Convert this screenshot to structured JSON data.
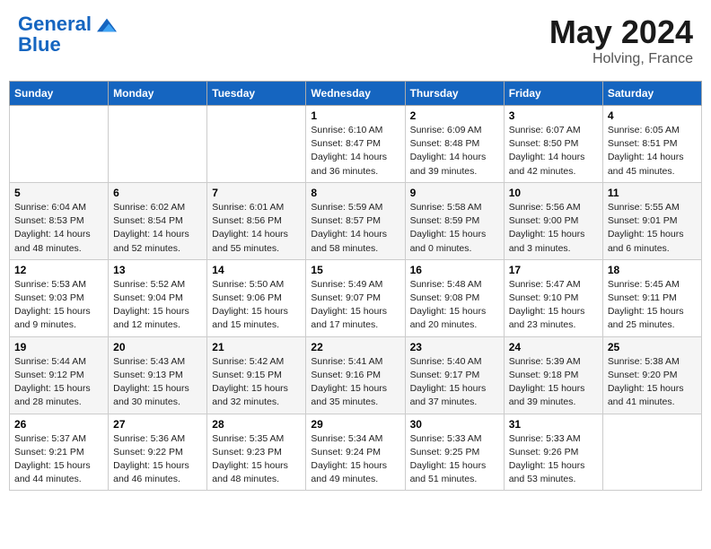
{
  "header": {
    "logo_line1": "General",
    "logo_line2": "Blue",
    "month_year": "May 2024",
    "location": "Holving, France"
  },
  "days_of_week": [
    "Sunday",
    "Monday",
    "Tuesday",
    "Wednesday",
    "Thursday",
    "Friday",
    "Saturday"
  ],
  "weeks": [
    [
      {
        "day": "",
        "content": ""
      },
      {
        "day": "",
        "content": ""
      },
      {
        "day": "",
        "content": ""
      },
      {
        "day": "1",
        "content": "Sunrise: 6:10 AM\nSunset: 8:47 PM\nDaylight: 14 hours\nand 36 minutes."
      },
      {
        "day": "2",
        "content": "Sunrise: 6:09 AM\nSunset: 8:48 PM\nDaylight: 14 hours\nand 39 minutes."
      },
      {
        "day": "3",
        "content": "Sunrise: 6:07 AM\nSunset: 8:50 PM\nDaylight: 14 hours\nand 42 minutes."
      },
      {
        "day": "4",
        "content": "Sunrise: 6:05 AM\nSunset: 8:51 PM\nDaylight: 14 hours\nand 45 minutes."
      }
    ],
    [
      {
        "day": "5",
        "content": "Sunrise: 6:04 AM\nSunset: 8:53 PM\nDaylight: 14 hours\nand 48 minutes."
      },
      {
        "day": "6",
        "content": "Sunrise: 6:02 AM\nSunset: 8:54 PM\nDaylight: 14 hours\nand 52 minutes."
      },
      {
        "day": "7",
        "content": "Sunrise: 6:01 AM\nSunset: 8:56 PM\nDaylight: 14 hours\nand 55 minutes."
      },
      {
        "day": "8",
        "content": "Sunrise: 5:59 AM\nSunset: 8:57 PM\nDaylight: 14 hours\nand 58 minutes."
      },
      {
        "day": "9",
        "content": "Sunrise: 5:58 AM\nSunset: 8:59 PM\nDaylight: 15 hours\nand 0 minutes."
      },
      {
        "day": "10",
        "content": "Sunrise: 5:56 AM\nSunset: 9:00 PM\nDaylight: 15 hours\nand 3 minutes."
      },
      {
        "day": "11",
        "content": "Sunrise: 5:55 AM\nSunset: 9:01 PM\nDaylight: 15 hours\nand 6 minutes."
      }
    ],
    [
      {
        "day": "12",
        "content": "Sunrise: 5:53 AM\nSunset: 9:03 PM\nDaylight: 15 hours\nand 9 minutes."
      },
      {
        "day": "13",
        "content": "Sunrise: 5:52 AM\nSunset: 9:04 PM\nDaylight: 15 hours\nand 12 minutes."
      },
      {
        "day": "14",
        "content": "Sunrise: 5:50 AM\nSunset: 9:06 PM\nDaylight: 15 hours\nand 15 minutes."
      },
      {
        "day": "15",
        "content": "Sunrise: 5:49 AM\nSunset: 9:07 PM\nDaylight: 15 hours\nand 17 minutes."
      },
      {
        "day": "16",
        "content": "Sunrise: 5:48 AM\nSunset: 9:08 PM\nDaylight: 15 hours\nand 20 minutes."
      },
      {
        "day": "17",
        "content": "Sunrise: 5:47 AM\nSunset: 9:10 PM\nDaylight: 15 hours\nand 23 minutes."
      },
      {
        "day": "18",
        "content": "Sunrise: 5:45 AM\nSunset: 9:11 PM\nDaylight: 15 hours\nand 25 minutes."
      }
    ],
    [
      {
        "day": "19",
        "content": "Sunrise: 5:44 AM\nSunset: 9:12 PM\nDaylight: 15 hours\nand 28 minutes."
      },
      {
        "day": "20",
        "content": "Sunrise: 5:43 AM\nSunset: 9:13 PM\nDaylight: 15 hours\nand 30 minutes."
      },
      {
        "day": "21",
        "content": "Sunrise: 5:42 AM\nSunset: 9:15 PM\nDaylight: 15 hours\nand 32 minutes."
      },
      {
        "day": "22",
        "content": "Sunrise: 5:41 AM\nSunset: 9:16 PM\nDaylight: 15 hours\nand 35 minutes."
      },
      {
        "day": "23",
        "content": "Sunrise: 5:40 AM\nSunset: 9:17 PM\nDaylight: 15 hours\nand 37 minutes."
      },
      {
        "day": "24",
        "content": "Sunrise: 5:39 AM\nSunset: 9:18 PM\nDaylight: 15 hours\nand 39 minutes."
      },
      {
        "day": "25",
        "content": "Sunrise: 5:38 AM\nSunset: 9:20 PM\nDaylight: 15 hours\nand 41 minutes."
      }
    ],
    [
      {
        "day": "26",
        "content": "Sunrise: 5:37 AM\nSunset: 9:21 PM\nDaylight: 15 hours\nand 44 minutes."
      },
      {
        "day": "27",
        "content": "Sunrise: 5:36 AM\nSunset: 9:22 PM\nDaylight: 15 hours\nand 46 minutes."
      },
      {
        "day": "28",
        "content": "Sunrise: 5:35 AM\nSunset: 9:23 PM\nDaylight: 15 hours\nand 48 minutes."
      },
      {
        "day": "29",
        "content": "Sunrise: 5:34 AM\nSunset: 9:24 PM\nDaylight: 15 hours\nand 49 minutes."
      },
      {
        "day": "30",
        "content": "Sunrise: 5:33 AM\nSunset: 9:25 PM\nDaylight: 15 hours\nand 51 minutes."
      },
      {
        "day": "31",
        "content": "Sunrise: 5:33 AM\nSunset: 9:26 PM\nDaylight: 15 hours\nand 53 minutes."
      },
      {
        "day": "",
        "content": ""
      }
    ]
  ]
}
